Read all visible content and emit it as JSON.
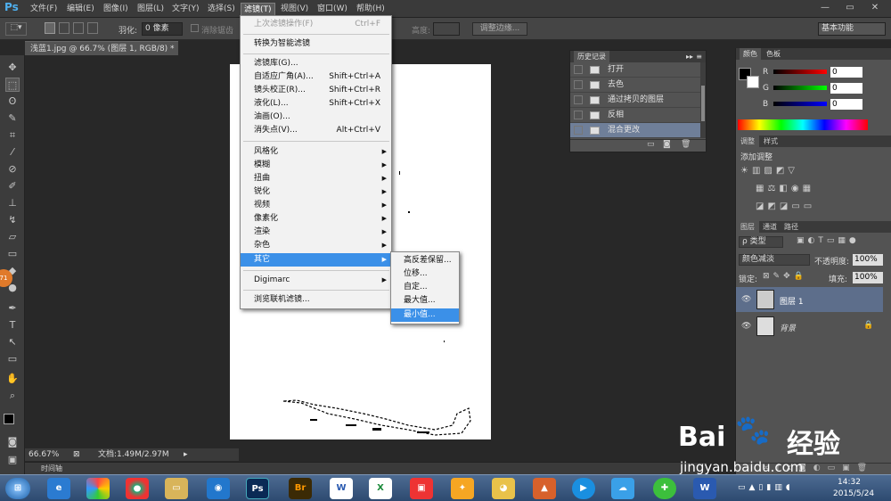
{
  "app": {
    "logo": "Ps"
  },
  "menubar": {
    "items": [
      "文件(F)",
      "编辑(E)",
      "图像(I)",
      "图层(L)",
      "文字(Y)",
      "选择(S)",
      "滤镜(T)",
      "视图(V)",
      "窗口(W)",
      "帮助(H)"
    ],
    "active": "滤镜(T)"
  },
  "window_controls": [
    "—",
    "▭",
    "✕"
  ],
  "options": {
    "feather_label": "羽化:",
    "feather_value": "0 像素",
    "antialias_label": "消除锯齿",
    "height_label": "高度:",
    "refine_edge": "调整边缘...",
    "workspace": "基本功能"
  },
  "document": {
    "tab_title": "浅蓝1.jpg @ 66.7% (图层 1, RGB/8) *",
    "zoom": "66.67%",
    "doc_size": "文档:1.49M/2.97M",
    "timeline": "时间轴"
  },
  "filter_menu": {
    "items": [
      {
        "label": "上次滤镜操作(F)",
        "shortcut": "Ctrl+F",
        "disabled": true
      },
      {
        "label": "转换为智能滤镜",
        "shortcut": ""
      },
      {
        "label": "滤镜库(G)...",
        "shortcut": ""
      },
      {
        "label": "自适应广角(A)...",
        "shortcut": "Shift+Ctrl+A"
      },
      {
        "label": "镜头校正(R)...",
        "shortcut": "Shift+Ctrl+R"
      },
      {
        "label": "液化(L)...",
        "shortcut": "Shift+Ctrl+X"
      },
      {
        "label": "油画(O)...",
        "shortcut": ""
      },
      {
        "label": "消失点(V)...",
        "shortcut": "Alt+Ctrl+V"
      },
      {
        "label": "风格化",
        "shortcut": ""
      },
      {
        "label": "模糊",
        "shortcut": ""
      },
      {
        "label": "扭曲",
        "shortcut": ""
      },
      {
        "label": "锐化",
        "shortcut": ""
      },
      {
        "label": "视频",
        "shortcut": ""
      },
      {
        "label": "像素化",
        "shortcut": ""
      },
      {
        "label": "渲染",
        "shortcut": ""
      },
      {
        "label": "杂色",
        "shortcut": ""
      },
      {
        "label": "其它",
        "shortcut": ""
      },
      {
        "label": "Digimarc",
        "shortcut": ""
      },
      {
        "label": "浏览联机滤镜...",
        "shortcut": ""
      }
    ]
  },
  "other_submenu": {
    "items": [
      "高反差保留...",
      "位移...",
      "自定...",
      "最大值...",
      "最小值..."
    ],
    "highlighted": "最小值..."
  },
  "history_panel": {
    "tabs": [
      "历史记录"
    ],
    "items": [
      "打开",
      "去色",
      "通过拷贝的图层",
      "反相",
      "混合更改"
    ],
    "selected": "混合更改"
  },
  "color_panel": {
    "tabs": [
      "颜色",
      "色板"
    ],
    "channels": [
      {
        "label": "R",
        "value": "0"
      },
      {
        "label": "G",
        "value": "0"
      },
      {
        "label": "B",
        "value": "0"
      }
    ]
  },
  "adjust_panel": {
    "tabs": [
      "调整",
      "样式"
    ],
    "title": "添加调整"
  },
  "layers_panel": {
    "tabs": [
      "图层",
      "通道",
      "路径"
    ],
    "kind": "ρ 类型",
    "blend_mode": "颜色减淡",
    "opacity_label": "不透明度:",
    "opacity": "100%",
    "lock_label": "锁定:",
    "fill_label": "填充:",
    "fill": "100%",
    "layers": [
      {
        "name": "图层 1"
      },
      {
        "name": "背景"
      }
    ]
  },
  "taskbar": {
    "time": "14:32",
    "date": "2015/5/24"
  },
  "watermark": {
    "brand": "Bai",
    "brand2": "经验",
    "url": "jingyan.baidu.com"
  },
  "badge": "71"
}
